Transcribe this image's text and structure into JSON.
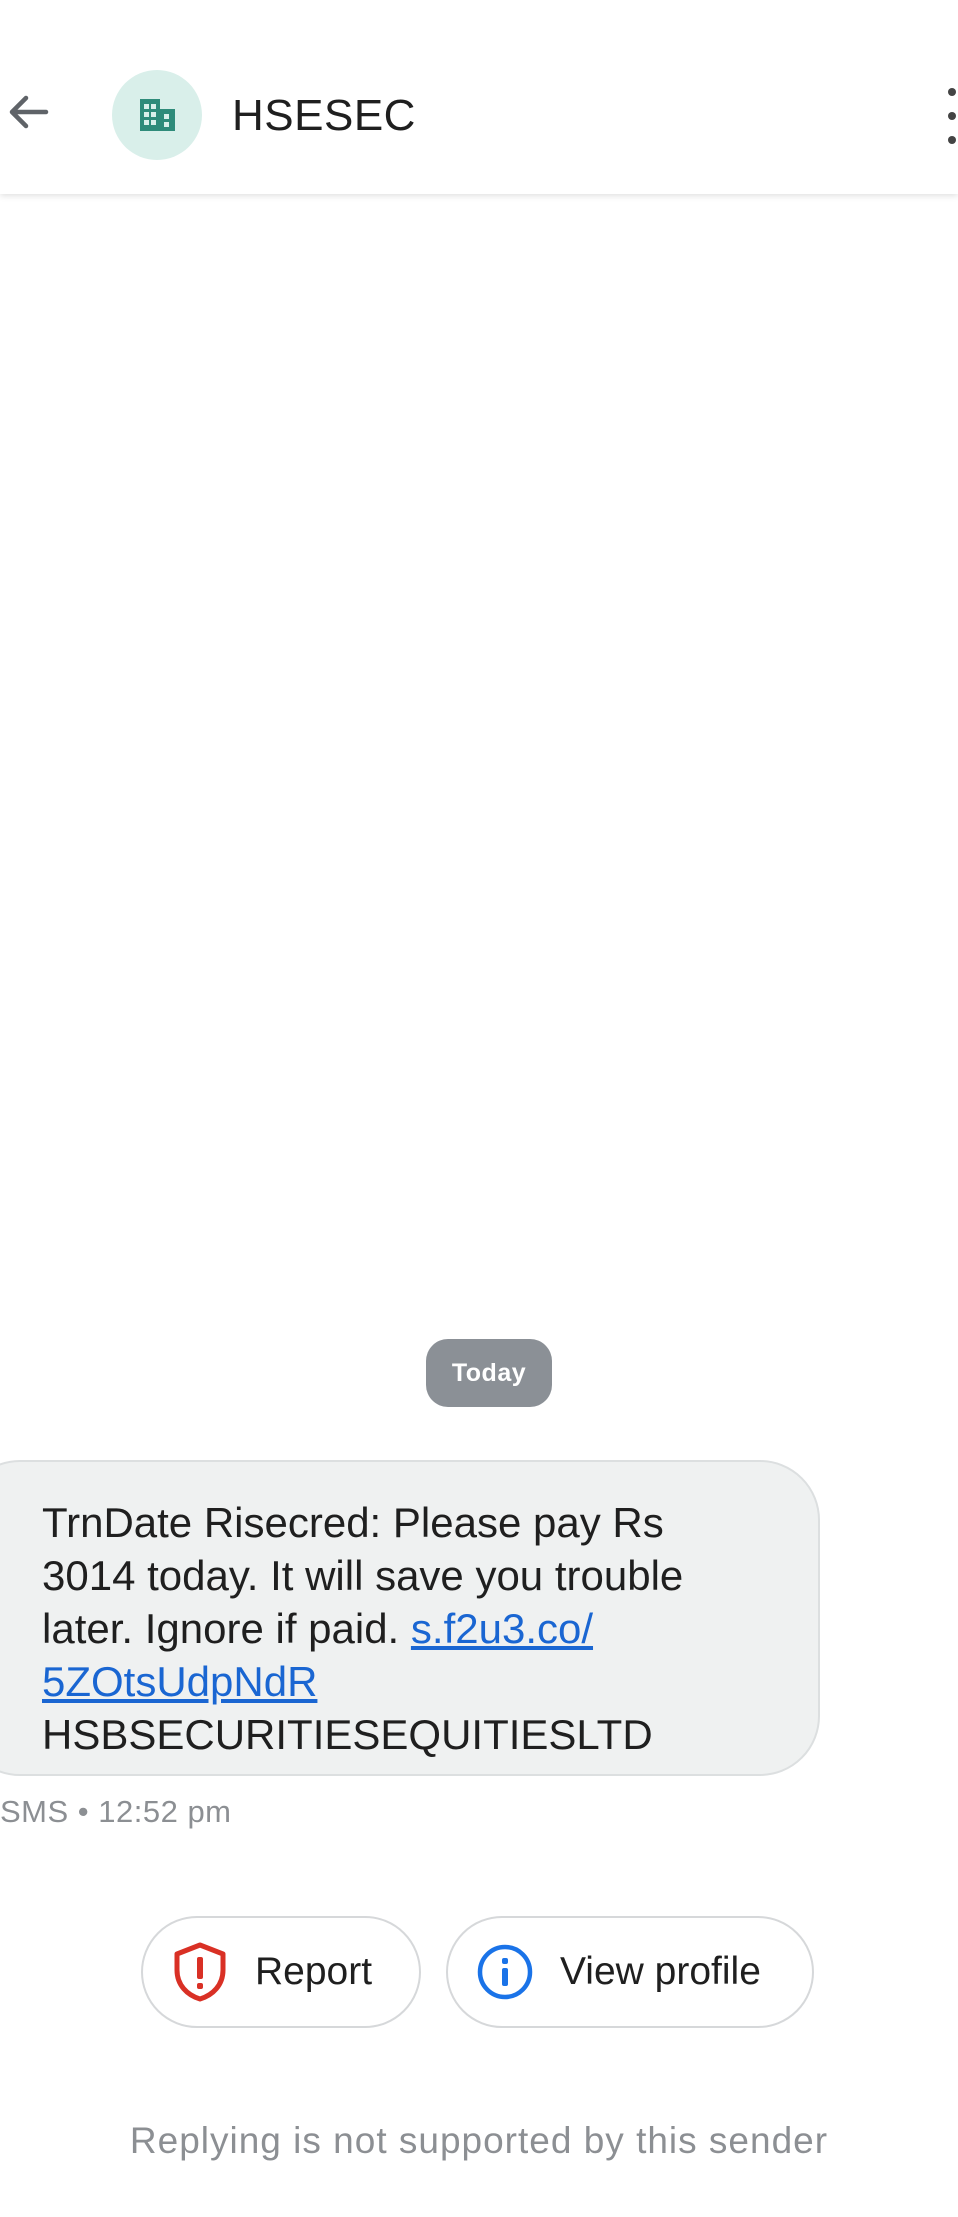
{
  "header": {
    "title": "HSESEC",
    "back_icon": "arrow-back-icon",
    "avatar_icon": "business-icon",
    "more_icon": "more-vert-icon",
    "avatar_bg": "#d9efea",
    "avatar_fg": "#2e8b7a"
  },
  "conversation": {
    "date_label": "Today",
    "message": {
      "line1": "TrnDate Risecred: Please pay Rs",
      "line2": "3014 today. It will save you trouble",
      "line3_text": "later. Ignore if paid. ",
      "link_part1": "s.f2u3.co/",
      "link_part2": "5ZOtsUdpNdR",
      "sender_line": "HSBSECURITIESEQUITIESLTD"
    },
    "meta": "SMS • 12:52 pm"
  },
  "actions": {
    "report_label": "Report",
    "report_icon": "shield-alert-icon",
    "report_color": "#d93025",
    "profile_label": "View profile",
    "profile_icon": "info-icon",
    "profile_color": "#1a73e8"
  },
  "footer": {
    "note": "Replying is not supported by this sender"
  }
}
